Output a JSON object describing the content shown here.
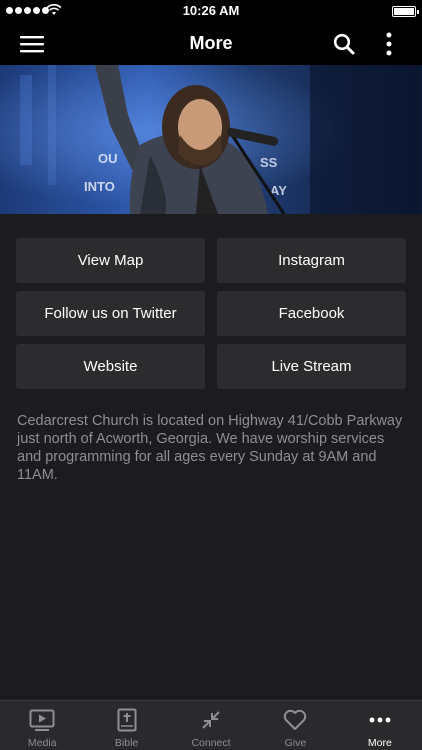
{
  "status_bar": {
    "time": "10:26 AM",
    "signal_bars": 5,
    "battery_level": 1.0
  },
  "nav": {
    "title": "More",
    "left_icon": "hamburger-menu-icon",
    "right_icons": [
      "search-icon",
      "vertical-ellipsis-icon"
    ]
  },
  "hero": {
    "subject": "worship leader singing into a microphone with raised arm"
  },
  "links": [
    {
      "label": "View Map"
    },
    {
      "label": "Instagram"
    },
    {
      "label": "Follow us on Twitter"
    },
    {
      "label": "Facebook"
    },
    {
      "label": "Website"
    },
    {
      "label": "Live Stream"
    }
  ],
  "about_text": "Cedarcrest Church is located on Highway 41/Cobb Parkway just north of Acworth, Georgia.  We have worship services and programming for all ages every Sunday at 9AM and 11AM.",
  "tabs": [
    {
      "label": "Media",
      "icon": "play-video-icon",
      "active": false
    },
    {
      "label": "Bible",
      "icon": "bible-icon",
      "active": false
    },
    {
      "label": "Connect",
      "icon": "connect-arrows-icon",
      "active": false
    },
    {
      "label": "Give",
      "icon": "heart-icon",
      "active": false
    },
    {
      "label": "More",
      "icon": "more-dots-icon",
      "active": true
    }
  ],
  "colors": {
    "background": "#1c1c1e",
    "bar": "#000000",
    "tile": "#2c2c2e",
    "body_text": "#8e8e93",
    "active_tab": "#ffffff"
  }
}
